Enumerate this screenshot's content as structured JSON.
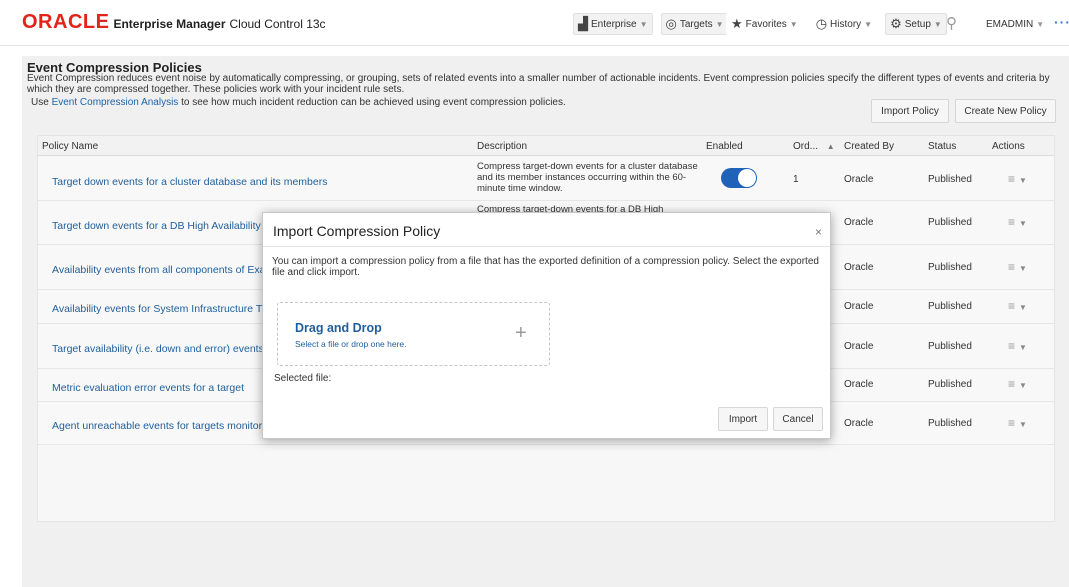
{
  "header": {
    "brand": "ORACLE",
    "product": "Enterprise Manager",
    "version": "Cloud Control 13c",
    "menus": [
      {
        "label": "Enterprise",
        "icon": "enterprise-icon"
      },
      {
        "label": "Targets",
        "icon": "targets-icon"
      },
      {
        "label": "Favorites",
        "icon": "star-icon"
      },
      {
        "label": "History",
        "icon": "history-clock-icon"
      },
      {
        "label": "Setup",
        "icon": "gear-icon"
      }
    ],
    "user": "EMADMIN"
  },
  "page": {
    "title": "Event Compression Policies",
    "description": "Event Compression reduces event noise by automatically compressing, or grouping, sets of related events into a smaller number of actionable incidents. Event compression policies specify the different types of events and criteria by which they are compressed together. These policies work with your incident rule sets.",
    "use_prefix": "Use",
    "analysis_link": "Event Compression Analysis",
    "use_suffix": "to see how much incident reduction can be achieved using event compression policies.",
    "import_button": "Import Policy",
    "create_button": "Create New Policy"
  },
  "table": {
    "columns": {
      "name": "Policy Name",
      "description": "Description",
      "enabled": "Enabled",
      "order": "Ord...",
      "created_by": "Created By",
      "status": "Status",
      "actions": "Actions"
    },
    "rows": [
      {
        "name": "Target down events for a cluster database and its members",
        "description": "Compress target-down events for a cluster database and its member instances occurring within the 60-minute time window.",
        "enabled": true,
        "order": "1",
        "created_by": "Oracle",
        "status": "Published"
      },
      {
        "name": "Target down events for a DB High Availability",
        "description": "Compress target-down events for a DB High",
        "created_by": "Oracle",
        "status": "Published"
      },
      {
        "name": "Availability events from all components of Exa",
        "created_by": "Oracle",
        "status": "Published"
      },
      {
        "name": "Availability events for System Infrastructure T",
        "created_by": "Oracle",
        "status": "Published"
      },
      {
        "name": "Target availability (i.e. down and error) events",
        "created_by": "Oracle",
        "status": "Published"
      },
      {
        "name": "Metric evaluation error events for a target",
        "created_by": "Oracle",
        "status": "Published"
      },
      {
        "name": "Agent unreachable events for targets monitor",
        "created_by": "Oracle",
        "status": "Published"
      }
    ]
  },
  "dialog": {
    "title": "Import Compression Policy",
    "close": "×",
    "text": "You can import a compression policy from a file that has the exported definition of a compression policy. Select the exported file and click import.",
    "dropzone_title": "Drag and Drop",
    "dropzone_sub": "Select a file or drop one here.",
    "selected_file_label": "Selected file:",
    "import_button": "Import",
    "cancel_button": "Cancel"
  }
}
